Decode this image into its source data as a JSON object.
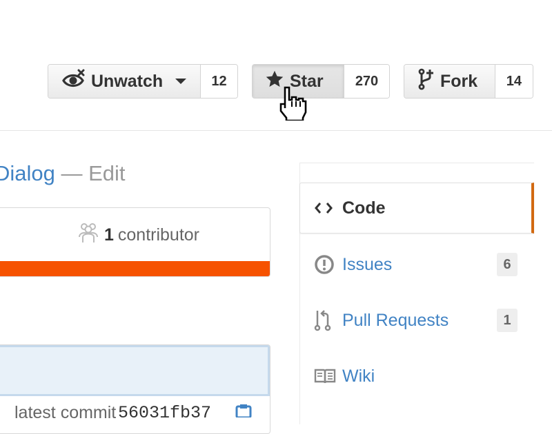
{
  "actions": {
    "watch": {
      "label": "Unwatch",
      "count": "12"
    },
    "star": {
      "label": "Star",
      "count": "270"
    },
    "fork": {
      "label": "Fork",
      "count": "14"
    }
  },
  "file_header": {
    "title_link": "Dialog",
    "title_suffix": " — Edit"
  },
  "contributors": {
    "count": "1",
    "label": "contributor",
    "language_bar_color": "#f65200"
  },
  "commit": {
    "meta_text": "latest commit",
    "sha": "56031fb37"
  },
  "nav": {
    "items": [
      {
        "label": "Code",
        "icon": "code-icon",
        "selected": true
      },
      {
        "label": "Issues",
        "icon": "issue-icon",
        "counter": "6"
      },
      {
        "label": "Pull Requests",
        "icon": "pull-request-icon",
        "counter": "1"
      },
      {
        "label": "Wiki",
        "icon": "book-icon"
      }
    ],
    "selected_accent": "#d26911"
  },
  "colors": {
    "link": "#4183c4",
    "text": "#333333",
    "muted": "#999999"
  }
}
